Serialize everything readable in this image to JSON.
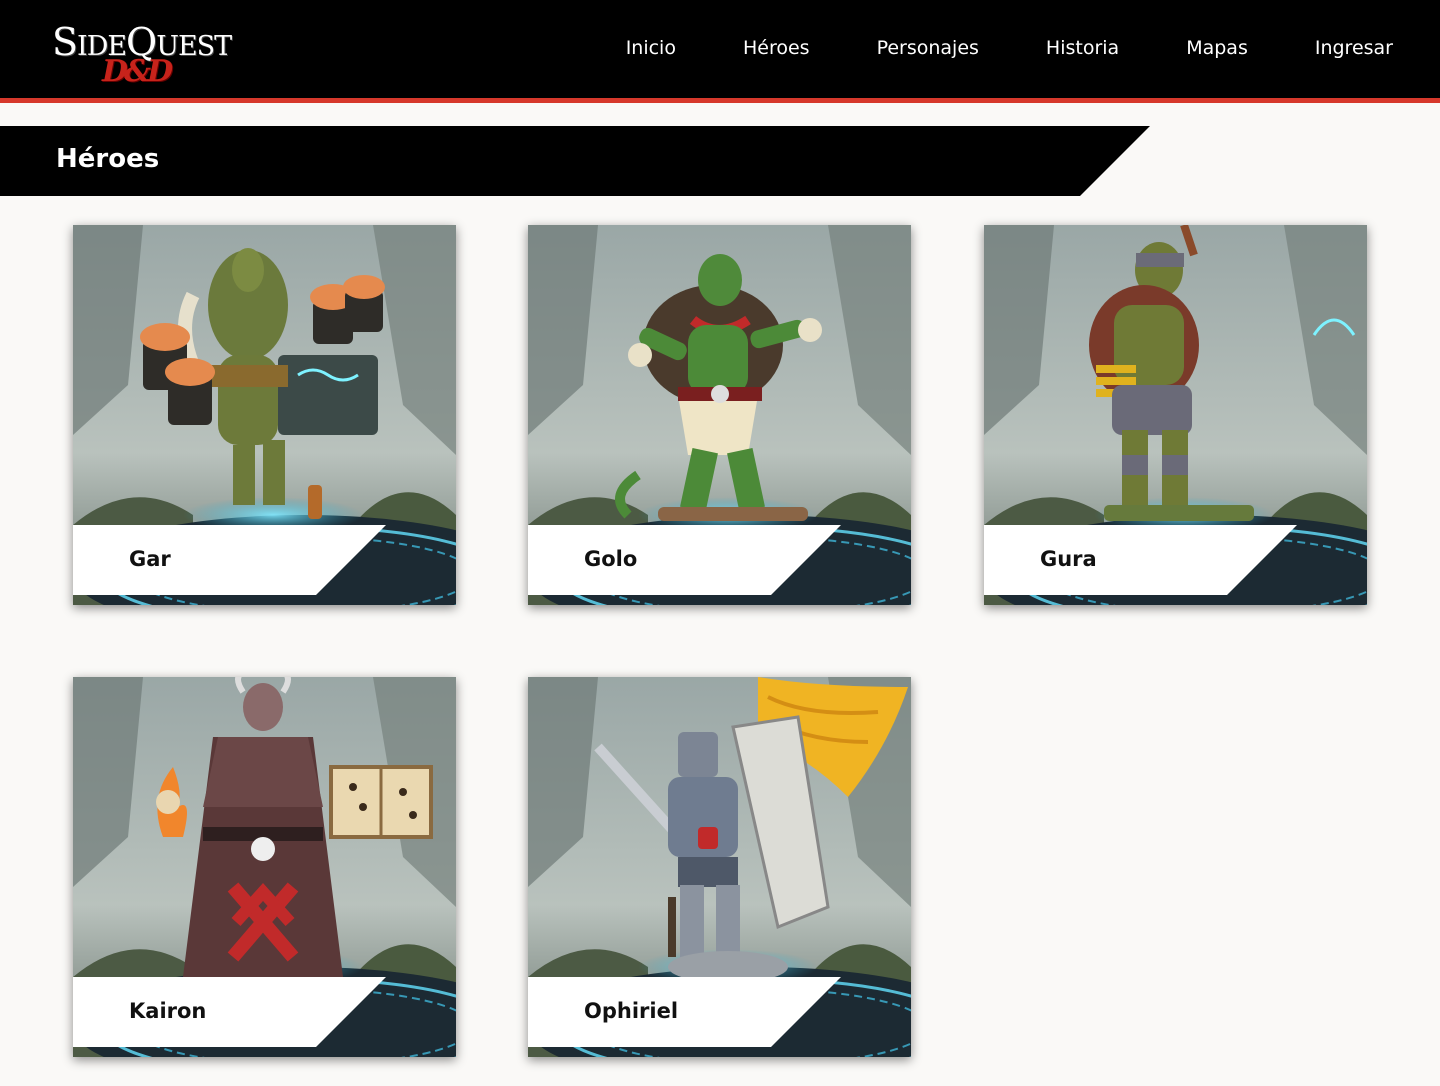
{
  "brand": {
    "name": "SideQuest",
    "sub": "D&D"
  },
  "nav": {
    "items": [
      "Inicio",
      "Héroes",
      "Personajes",
      "Historia",
      "Mapas",
      "Ingresar"
    ]
  },
  "section": {
    "title": "Héroes"
  },
  "heroes": [
    {
      "name": "Gar",
      "figure": "tortle-brewer"
    },
    {
      "name": "Golo",
      "figure": "tortle-monk"
    },
    {
      "name": "Gura",
      "figure": "tortle-rogue"
    },
    {
      "name": "Kairon",
      "figure": "tiefling-warlock"
    },
    {
      "name": "Ophiriel",
      "figure": "aasimar-paladin"
    }
  ],
  "colors": {
    "header_bg": "#000000",
    "accent_stripe": "#d6382b",
    "page_bg": "#faf9f7"
  }
}
